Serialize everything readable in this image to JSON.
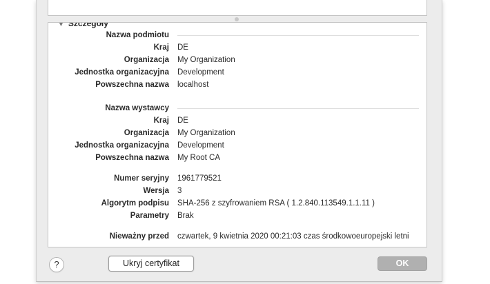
{
  "details": {
    "header": "Szczegóły",
    "subject": {
      "title": "Nazwa podmiotu",
      "rows": [
        {
          "label": "Kraj",
          "value": "DE"
        },
        {
          "label": "Organizacja",
          "value": "My Organization"
        },
        {
          "label": "Jednostka organizacyjna",
          "value": "Development"
        },
        {
          "label": "Powszechna nazwa",
          "value": "localhost"
        }
      ]
    },
    "issuer": {
      "title": "Nazwa wystawcy",
      "rows": [
        {
          "label": "Kraj",
          "value": "DE"
        },
        {
          "label": "Organizacja",
          "value": "My Organization"
        },
        {
          "label": "Jednostka organizacyjna",
          "value": "Development"
        },
        {
          "label": "Powszechna nazwa",
          "value": "My Root CA"
        }
      ]
    },
    "cert": {
      "rows": [
        {
          "label": "Numer seryjny",
          "value": "1961779521"
        },
        {
          "label": "Wersja",
          "value": "3"
        },
        {
          "label": "Algorytm podpisu",
          "value": "SHA-256 z szyfrowaniem RSA ( 1.2.840.113549.1.1.11 )"
        },
        {
          "label": "Parametry",
          "value": "Brak"
        }
      ]
    },
    "validity": {
      "rows": [
        {
          "label": "Nieważny przed",
          "value": "czwartek, 9 kwietnia 2020 00:21:03 czas środkowoeuropejski letni"
        }
      ]
    }
  },
  "buttons": {
    "help": "?",
    "hide_cert": "Ukryj certyfikat",
    "ok": "OK"
  }
}
